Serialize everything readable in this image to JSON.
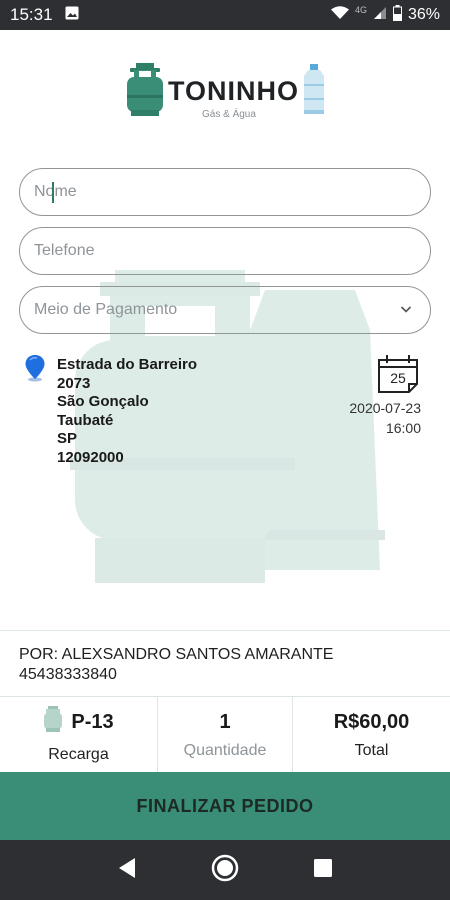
{
  "status_bar": {
    "time": "15:31",
    "network": "4G",
    "battery": "36%"
  },
  "brand": {
    "name": "TONINHO",
    "subtitle": "Gás & Água"
  },
  "form": {
    "name_placeholder": "Nome",
    "phone_placeholder": "Telefone",
    "payment_placeholder": "Meio de Pagamento"
  },
  "address": {
    "street": "Estrada do Barreiro",
    "number": "2073",
    "neighborhood": "São Gonçalo",
    "city": "Taubaté",
    "state": "SP",
    "zip": "12092000"
  },
  "schedule": {
    "calendar_day": "25",
    "date": "2020-07-23",
    "time": "16:00"
  },
  "seller": {
    "by_label": "POR: ALEXSANDRO SANTOS AMARANTE",
    "document": "45438333840"
  },
  "summary": {
    "product": "P-13",
    "product_label": "Recarga",
    "quantity": "1",
    "quantity_label": "Quantidade",
    "total": "R$60,00",
    "total_label": "Total"
  },
  "actions": {
    "finalize_label": "FINALIZAR PEDIDO"
  },
  "colors": {
    "accent": "#3a8d76",
    "status_bar": "#2d2f33"
  },
  "icons": [
    "image-icon",
    "wifi-icon",
    "signal-icon",
    "battery-icon",
    "gas-cylinder-icon",
    "water-jug-icon",
    "chevron-down-icon",
    "location-pin-icon",
    "calendar-icon",
    "back-icon",
    "home-icon",
    "recents-icon"
  ]
}
